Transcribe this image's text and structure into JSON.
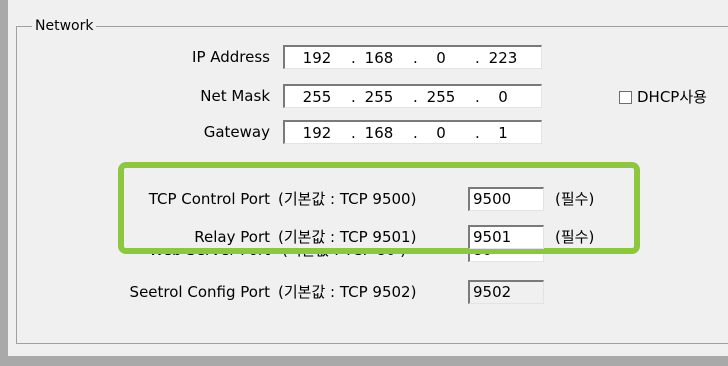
{
  "group_title": "Network",
  "ip_address": {
    "label": "IP Address",
    "octets": [
      "192",
      "168",
      "0",
      "223"
    ]
  },
  "net_mask": {
    "label": "Net Mask",
    "octets": [
      "255",
      "255",
      "255",
      "0"
    ]
  },
  "gateway": {
    "label": "Gateway",
    "octets": [
      "192",
      "168",
      "0",
      "1"
    ]
  },
  "dhcp": {
    "label": "DHCP사용",
    "checked": false
  },
  "tcp_control_port": {
    "label": "TCP Control Port",
    "hint": "(기본값 : TCP 9500)",
    "value": "9500",
    "required": "(필수)"
  },
  "relay_port": {
    "label": "Relay Port",
    "hint": "(기본값 : TCP 9501)",
    "value": "9501",
    "required": "(필수)"
  },
  "web_server_port": {
    "label": "Web Server Port",
    "hint": "(기본값 : TCP 80 )",
    "value": "80"
  },
  "seetrol_config_port": {
    "label": "Seetrol Config Port",
    "hint": "(기본값 : TCP 9502)",
    "value": "9502"
  },
  "highlight_color": "#8dc63f"
}
